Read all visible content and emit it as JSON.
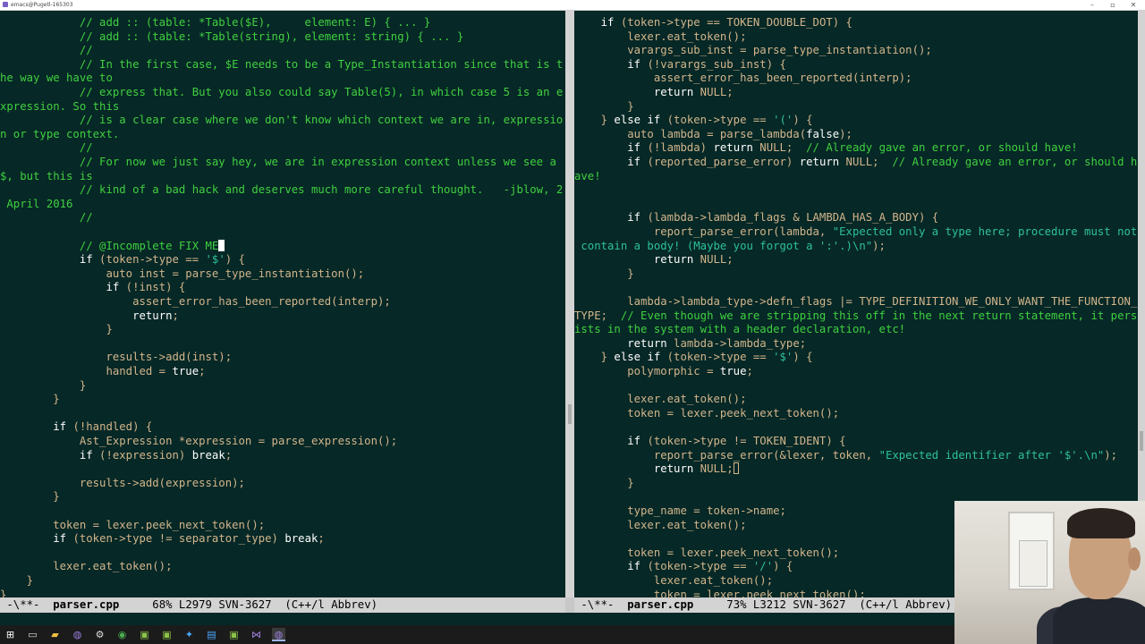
{
  "window": {
    "title": "emacs@Pugetl-165303"
  },
  "left": {
    "lines": [
      [
        [
          "c",
          "            // add :: (table: *Table($E),     element: E) { ... }"
        ]
      ],
      [
        [
          "c",
          "            // add :: (table: *Table(string), element: string) { ... }"
        ]
      ],
      [
        [
          "c",
          "            //"
        ]
      ],
      [
        [
          "c",
          "            // In the first case, $E needs to be a Type_Instantiation since that is t"
        ]
      ],
      [
        [
          "c",
          "he way we have to"
        ]
      ],
      [
        [
          "c",
          "            // express that. But you also could say Table(5), in which case 5 is an e"
        ]
      ],
      [
        [
          "c",
          "xpression. So this"
        ]
      ],
      [
        [
          "c",
          "            // is a clear case where we don't know which context we are in, expressio"
        ]
      ],
      [
        [
          "c",
          "n or type context."
        ]
      ],
      [
        [
          "c",
          "            //"
        ]
      ],
      [
        [
          "c",
          "            // For now we just say hey, we are in expression context unless we see a"
        ]
      ],
      [
        [
          "c",
          "$, but this is"
        ]
      ],
      [
        [
          "c",
          "            // kind of a bad hack and deserves much more careful thought.   -jblow, 2"
        ]
      ],
      [
        [
          "c",
          " April 2016"
        ]
      ],
      [
        [
          "c",
          "            //"
        ]
      ],
      [
        [
          "t",
          ""
        ]
      ],
      [
        [
          "c",
          "            // @Incomplete FIX ME"
        ]
      ],
      [
        [
          "t",
          "            "
        ],
        [
          "k",
          "if"
        ],
        [
          "t",
          " (token->type == "
        ],
        [
          "s",
          "'$'"
        ],
        [
          "t",
          ") {"
        ]
      ],
      [
        [
          "t",
          "                auto inst = parse_type_instantiation();"
        ]
      ],
      [
        [
          "t",
          "                "
        ],
        [
          "k",
          "if"
        ],
        [
          "t",
          " (!inst) {"
        ]
      ],
      [
        [
          "t",
          "                    assert_error_has_been_reported(interp);"
        ]
      ],
      [
        [
          "t",
          "                    "
        ],
        [
          "k",
          "return"
        ],
        [
          "t",
          ";"
        ]
      ],
      [
        [
          "t",
          "                }"
        ]
      ],
      [
        [
          "t",
          ""
        ]
      ],
      [
        [
          "t",
          "                results->add(inst);"
        ]
      ],
      [
        [
          "t",
          "                handled = "
        ],
        [
          "k",
          "true"
        ],
        [
          "t",
          ";"
        ]
      ],
      [
        [
          "t",
          "            }"
        ]
      ],
      [
        [
          "t",
          "        }"
        ]
      ],
      [
        [
          "t",
          ""
        ]
      ],
      [
        [
          "t",
          "        "
        ],
        [
          "k",
          "if"
        ],
        [
          "t",
          " (!handled) {"
        ]
      ],
      [
        [
          "t",
          "            Ast_Expression *expression = parse_expression();"
        ]
      ],
      [
        [
          "t",
          "            "
        ],
        [
          "k",
          "if"
        ],
        [
          "t",
          " (!expression) "
        ],
        [
          "k",
          "break"
        ],
        [
          "t",
          ";"
        ]
      ],
      [
        [
          "t",
          ""
        ]
      ],
      [
        [
          "t",
          "            results->add(expression);"
        ]
      ],
      [
        [
          "t",
          "        }"
        ]
      ],
      [
        [
          "t",
          ""
        ]
      ],
      [
        [
          "t",
          "        token = lexer.peek_next_token();"
        ]
      ],
      [
        [
          "t",
          "        "
        ],
        [
          "k",
          "if"
        ],
        [
          "t",
          " (token->type != separator_type) "
        ],
        [
          "k",
          "break"
        ],
        [
          "t",
          ";"
        ]
      ],
      [
        [
          "t",
          ""
        ]
      ],
      [
        [
          "t",
          "        lexer.eat_token();"
        ]
      ],
      [
        [
          "t",
          "    }"
        ]
      ],
      [
        [
          "t",
          "}"
        ]
      ]
    ]
  },
  "right": {
    "lines": [
      [
        [
          "t",
          "    "
        ],
        [
          "k",
          "if"
        ],
        [
          "t",
          " (token->type == TOKEN_DOUBLE_DOT) {"
        ]
      ],
      [
        [
          "t",
          "        lexer.eat_token();"
        ]
      ],
      [
        [
          "t",
          "        varargs_sub_inst = parse_type_instantiation();"
        ]
      ],
      [
        [
          "t",
          "        "
        ],
        [
          "k",
          "if"
        ],
        [
          "t",
          " (!varargs_sub_inst) {"
        ]
      ],
      [
        [
          "t",
          "            assert_error_has_been_reported(interp);"
        ]
      ],
      [
        [
          "t",
          "            "
        ],
        [
          "k",
          "return"
        ],
        [
          "t",
          " NULL;"
        ]
      ],
      [
        [
          "t",
          "        }"
        ]
      ],
      [
        [
          "t",
          "    } "
        ],
        [
          "k",
          "else if"
        ],
        [
          "t",
          " (token->type == "
        ],
        [
          "s",
          "'('"
        ],
        [
          "t",
          ") {"
        ]
      ],
      [
        [
          "t",
          "        auto lambda = parse_lambda("
        ],
        [
          "k",
          "false"
        ],
        [
          "t",
          ");"
        ]
      ],
      [
        [
          "t",
          "        "
        ],
        [
          "k",
          "if"
        ],
        [
          "t",
          " (!lambda) "
        ],
        [
          "k",
          "return"
        ],
        [
          "t",
          " NULL;  "
        ],
        [
          "c",
          "// Already gave an error, or should have!"
        ]
      ],
      [
        [
          "t",
          "        "
        ],
        [
          "k",
          "if"
        ],
        [
          "t",
          " (reported_parse_error) "
        ],
        [
          "k",
          "return"
        ],
        [
          "t",
          " NULL;  "
        ],
        [
          "c",
          "// Already gave an error, or should h"
        ]
      ],
      [
        [
          "c",
          "ave!"
        ]
      ],
      [
        [
          "t",
          ""
        ]
      ],
      [
        [
          "t",
          ""
        ]
      ],
      [
        [
          "t",
          "        "
        ],
        [
          "k",
          "if"
        ],
        [
          "t",
          " (lambda->lambda_flags & LAMBDA_HAS_A_BODY) {"
        ]
      ],
      [
        [
          "t",
          "            report_parse_error(lambda, "
        ],
        [
          "s",
          "\"Expected only a type here; procedure must not"
        ]
      ],
      [
        [
          "s",
          " contain a body! (Maybe you forgot a ':'.)\\n\""
        ],
        [
          "t",
          ");"
        ]
      ],
      [
        [
          "t",
          "            "
        ],
        [
          "k",
          "return"
        ],
        [
          "t",
          " NULL;"
        ]
      ],
      [
        [
          "t",
          "        }"
        ]
      ],
      [
        [
          "t",
          ""
        ]
      ],
      [
        [
          "t",
          "        lambda->lambda_type->defn_flags |= TYPE_DEFINITION_WE_ONLY_WANT_THE_FUNCTION_"
        ]
      ],
      [
        [
          "t",
          "TYPE;  "
        ],
        [
          "c",
          "// Even though we are stripping this off in the next return statement, it pers"
        ]
      ],
      [
        [
          "c",
          "ists in the system with a header declaration, etc!"
        ]
      ],
      [
        [
          "t",
          "        "
        ],
        [
          "k",
          "return"
        ],
        [
          "t",
          " lambda->lambda_type;"
        ]
      ],
      [
        [
          "t",
          "    } "
        ],
        [
          "k",
          "else if"
        ],
        [
          "t",
          " (token->type == "
        ],
        [
          "s",
          "'$'"
        ],
        [
          "t",
          ") {"
        ]
      ],
      [
        [
          "t",
          "        polymorphic = "
        ],
        [
          "k",
          "true"
        ],
        [
          "t",
          ";"
        ]
      ],
      [
        [
          "t",
          ""
        ]
      ],
      [
        [
          "t",
          "        lexer.eat_token();"
        ]
      ],
      [
        [
          "t",
          "        token = lexer.peek_next_token();"
        ]
      ],
      [
        [
          "t",
          ""
        ]
      ],
      [
        [
          "t",
          "        "
        ],
        [
          "k",
          "if"
        ],
        [
          "t",
          " (token->type != TOKEN_IDENT) {"
        ]
      ],
      [
        [
          "t",
          "            report_parse_error(&lexer, token, "
        ],
        [
          "s",
          "\"Expected identifier after '$'.\\n\""
        ],
        [
          "t",
          ");"
        ]
      ],
      [
        [
          "t",
          "            "
        ],
        [
          "k",
          "return"
        ],
        [
          "t",
          " NULL;"
        ]
      ],
      [
        [
          "t",
          "        }"
        ]
      ],
      [
        [
          "t",
          ""
        ]
      ],
      [
        [
          "t",
          "        type_name = token->name;"
        ]
      ],
      [
        [
          "t",
          "        lexer.eat_token();"
        ]
      ],
      [
        [
          "t",
          ""
        ]
      ],
      [
        [
          "t",
          "        token = lexer.peek_next_token();"
        ]
      ],
      [
        [
          "t",
          "        "
        ],
        [
          "k",
          "if"
        ],
        [
          "t",
          " (token->type == "
        ],
        [
          "s",
          "'/'"
        ],
        [
          "t",
          ") {"
        ]
      ],
      [
        [
          "t",
          "            lexer.eat_token();"
        ]
      ],
      [
        [
          "t",
          "            token = lexer.peek_next_token();"
        ]
      ]
    ]
  },
  "modeline_left": {
    "status": " -\\**-  ",
    "buffer": "parser.cpp",
    "position": "     68% L2979 SVN-3627  (C++/l Abbrev)"
  },
  "modeline_right": {
    "status": " -\\**-  ",
    "buffer": "parser.cpp",
    "position": "     73% L3212 SVN-3627  (C++/l Abbrev)"
  },
  "taskbar": {
    "icons": [
      "windows-icon",
      "task-view-icon",
      "file-explorer-icon",
      "emacs-icon",
      "steam-icon",
      "chrome-icon",
      "app-icon",
      "app-icon",
      "tools-icon",
      "terminal-icon",
      "app-icon",
      "visual-studio-icon",
      "emacs-icon"
    ]
  },
  "colors": {
    "background": "#062826",
    "text": "#d2b58c",
    "comment": "#40d040",
    "keyword": "#ffffff",
    "string": "#2ec09c",
    "modeline": "#d3d3d3"
  }
}
